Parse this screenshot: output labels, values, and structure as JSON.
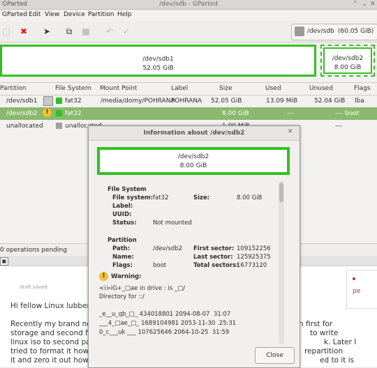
{
  "window": {
    "title": "/dev/sdb - GParted",
    "app_name": "GParted"
  },
  "menu": [
    "Edit",
    "View",
    "Device",
    "Partition",
    "Help"
  ],
  "device_selector": {
    "name": "/dev/sdb",
    "size": "(60.05 GiB)"
  },
  "graph": {
    "p1": {
      "name": "/dev/sdb1",
      "size": "52.05 GiB"
    },
    "p2": {
      "name": "/dev/sdb2",
      "size": "8.00 GiB"
    }
  },
  "table": {
    "headers": [
      "Partition",
      "File System",
      "Mount Point",
      "Label",
      "Size",
      "Used",
      "Unused",
      "Flags"
    ],
    "rows": [
      {
        "partition": "/dev/sdb1",
        "fs": "fat32",
        "mount": "/media/domy/POHRANA",
        "label": "POHRANA",
        "size": "52.05 GiB",
        "used": "13.09 MiB",
        "unused": "52.04 GiB",
        "flags": "lba"
      },
      {
        "partition": "/dev/sdb2",
        "fs": "fat32",
        "mount": "",
        "label": "",
        "size": "8.00 GiB",
        "used": "---",
        "unused": "---",
        "flags": "boot"
      },
      {
        "partition": "unallocated",
        "fs": "unallocated",
        "mount": "",
        "label": "",
        "size": "1.00 MiB",
        "used": "---",
        "unused": "---",
        "flags": ""
      }
    ]
  },
  "status": "0 operations pending",
  "browser": {
    "draft": "draft saved",
    "greeting": "Hi fellow Linux lubbers",
    "p1": "Recently my brand new",
    "p1b": "h first for",
    "p2": "storage and second for",
    "p2b": "to write",
    "p3": "linux iso to second part",
    "p3b": "k. Later I",
    "p4": "tried to format it howev",
    "p4b": "repartition",
    "p5": "it and zero it out howev",
    "p5b": "ed to it is",
    "side": "pe"
  },
  "dialog": {
    "title": "Information about /dev/sdb2",
    "graph_name": "/dev/sdb2",
    "graph_size": "8.00 GiB",
    "fs_heading": "File System",
    "fs_label": "File system:",
    "fs_value": "fat32",
    "size_label": "Size:",
    "size_value": "8.00 GiB",
    "label_label": "Label:",
    "uuid_label": "UUID:",
    "status_label": "Status:",
    "status_value": "Not mounted",
    "part_heading": "Partition",
    "path_label": "Path:",
    "path_value": "/dev/sdb2",
    "first_label": "First sector:",
    "first_value": "109152256",
    "name_label": "Name:",
    "last_label": "Last sector:",
    "last_value": "125925375",
    "flags_label": "Flags:",
    "flags_value": "boot",
    "total_label": "Total sectors:",
    "total_value": "16773120",
    "warning_heading": "Warning:",
    "warn1": "<i>iG+_□ae in drive : is _□/",
    "warn2": "Directory for ::/",
    "dir1": "_e__u_qb_□_ 434018801 2094-08-07  31:07",
    "dir2": "___4_□ae_□_ 1689104981 2053-11-30  25:31",
    "dir3": "0_c___uk ___ 107625646 2064-10-25  31:59",
    "close": "Close"
  }
}
